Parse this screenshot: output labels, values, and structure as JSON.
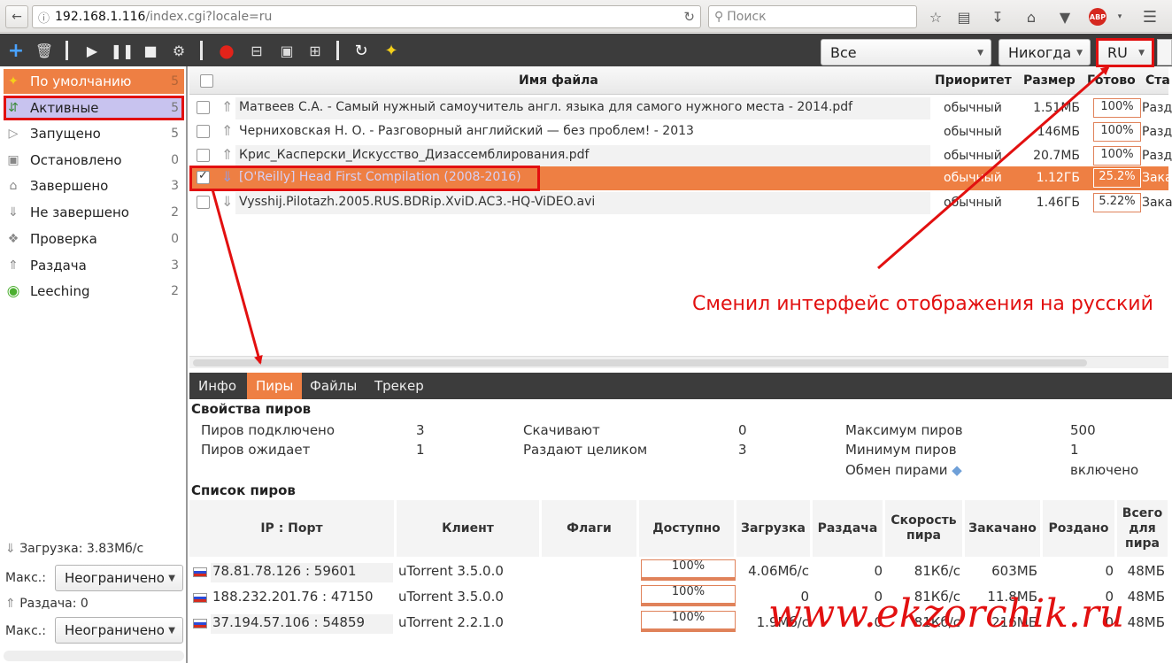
{
  "browser": {
    "url_host": "192.168.1.116",
    "url_path": "/index.cgi?locale=ru",
    "search_placeholder": "Поиск",
    "abp_label": "ABP"
  },
  "toolbar": {
    "filter_select": "Все",
    "schedule_select": "Никогда",
    "locale_select": "RU"
  },
  "sidebar": {
    "items": [
      {
        "label": "По умолчанию",
        "count": "5",
        "icon": "star-icon"
      },
      {
        "label": "Активные",
        "count": "5",
        "icon": "activity-icon"
      },
      {
        "label": "Запущено",
        "count": "5",
        "icon": "play-icon"
      },
      {
        "label": "Остановлено",
        "count": "0",
        "icon": "stop-icon"
      },
      {
        "label": "Завершено",
        "count": "3",
        "icon": "home-icon"
      },
      {
        "label": "Не завершено",
        "count": "2",
        "icon": "down-icon"
      },
      {
        "label": "Проверка",
        "count": "0",
        "icon": "check-icon"
      },
      {
        "label": "Раздача",
        "count": "3",
        "icon": "up-icon"
      },
      {
        "label": "Leeching",
        "count": "2",
        "icon": "leech-icon"
      }
    ],
    "download_label": "Загрузка: 3.83Мб/с",
    "max_label": "Макс.:",
    "download_limit": "Неограничено",
    "upload_label": "Раздача: 0",
    "upload_limit": "Неограничено"
  },
  "table": {
    "headers": {
      "name": "Имя файла",
      "priority": "Приоритет",
      "size": "Размер",
      "done": "Готово",
      "status": "Ста"
    },
    "rows": [
      {
        "name": "Матвеев С.А. - Самый нужный самоучитель англ. языка для самого нужного места - 2014.pdf",
        "priority": "обычный",
        "size": "1.51МБ",
        "done": "100%",
        "status": "Разд"
      },
      {
        "name": "Черниховская Н. О. - Разговорный английский — без проблем! - 2013",
        "priority": "обычный",
        "size": "146МБ",
        "done": "100%",
        "status": "Разд"
      },
      {
        "name": "Крис_Касперски_Искусство_Дизассемблирования.pdf",
        "priority": "обычный",
        "size": "20.7МБ",
        "done": "100%",
        "status": "Разд"
      },
      {
        "name": "[O'Reilly] Head First Compilation (2008-2016)",
        "priority": "обычный",
        "size": "1.12ГБ",
        "done": "25.2%",
        "status": "Зака"
      },
      {
        "name": "Vysshij.Pilotazh.2005.RUS.BDRip.XviD.AC3.-HQ-ViDEO.avi",
        "priority": "обычный",
        "size": "1.46ГБ",
        "done": "5.22%",
        "status": "Зака"
      }
    ]
  },
  "tabs": [
    "Инфо",
    "Пиры",
    "Файлы",
    "Трекер"
  ],
  "peer_props": {
    "title": "Свойства пиров",
    "connected_label": "Пиров подключено",
    "connected": "3",
    "waiting_label": "Пиров ожидает",
    "waiting": "1",
    "downloading_label": "Скачивают",
    "downloading": "0",
    "seeding_label": "Раздают целиком",
    "seeding": "3",
    "max_label": "Максимум пиров",
    "max": "500",
    "min_label": "Минимум пиров",
    "min": "1",
    "pex_label": "Обмен пирами",
    "pex": "включено"
  },
  "peer_list": {
    "title": "Список пиров",
    "headers": [
      "IP : Порт",
      "Клиент",
      "Флаги",
      "Доступно",
      "Загрузка",
      "Раздача",
      "Скорость пира",
      "Закачано",
      "Роздано",
      "Всего для пира"
    ],
    "rows": [
      {
        "ip": "78.81.78.126 : 59601",
        "client": "uTorrent 3.5.0.0",
        "avail": "100%",
        "down": "4.06Мб/с",
        "up": "0",
        "speed": "81Кб/с",
        "dl": "603МБ",
        "ul": "0",
        "total": "48МБ"
      },
      {
        "ip": "188.232.201.76 : 47150",
        "client": "uTorrent 3.5.0.0",
        "avail": "100%",
        "down": "0",
        "up": "0",
        "speed": "81Кб/с",
        "dl": "11.8МБ",
        "ul": "0",
        "total": "48МБ"
      },
      {
        "ip": "37.194.57.106 : 54859",
        "client": "uTorrent 2.2.1.0",
        "avail": "100%",
        "down": "1.9Мб/с",
        "up": "0",
        "speed": "81Кб/с",
        "dl": "216МБ",
        "ul": "0",
        "total": "48МБ"
      }
    ]
  },
  "annotation": "Сменил интерфейс отображения на русский",
  "watermark": "www.ekzorchik.ru"
}
